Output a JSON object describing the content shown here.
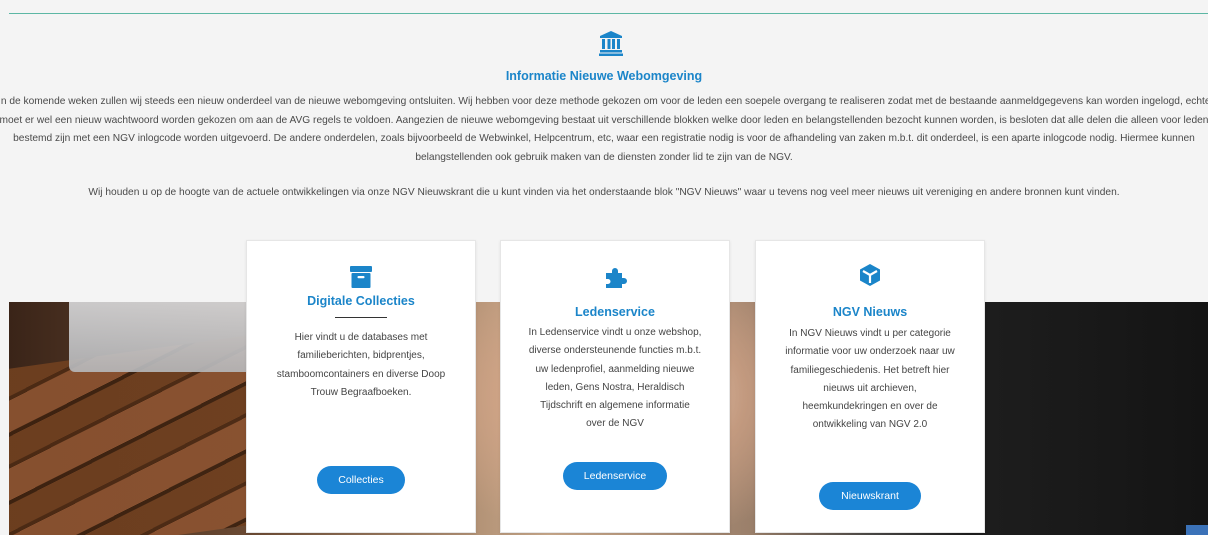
{
  "info": {
    "title": "Informatie Nieuwe Webomgeving",
    "paragraph_lines": [
      "In de komende weken zullen wij steeds een nieuw onderdeel van de nieuwe webomgeving ontsluiten. Wij hebben voor deze methode gekozen om voor de leden een soepele overgang te realiseren zodat met de bestaande aanmeldgegevens kan worden ingelogd, echter",
      "moet er wel een nieuw wachtwoord worden gekozen om aan de AVG regels te voldoen. Aangezien de nieuwe webomgeving bestaat uit verschillende blokken welke door leden en belangstellenden bezocht kunnen worden, is besloten dat alle delen die alleen voor leden",
      "bestemd zijn met een NGV inlogcode worden uitgevoerd. De andere onderdelen, zoals bijvoorbeeld de Webwinkel, Helpcentrum, etc, waar een registratie nodig is voor de afhandeling van zaken m.b.t. dit onderdeel, is een aparte inlogcode nodig. Hiermee kunnen",
      "belangstellenden ook gebruik maken van de diensten zonder lid te zijn van de NGV."
    ],
    "paragraph2": "Wij houden u op de hoogte van de actuele ontwikkelingen via onze NGV Nieuwskrant die u kunt vinden via het onderstaande blok \"NGV Nieuws\" waar u tevens nog veel meer nieuws uit vereniging en andere bronnen kunt vinden."
  },
  "cards": [
    {
      "icon": "archive-box-icon",
      "title": "Digitale Collecties",
      "body_lines": [
        "Hier vindt u de databases met",
        "familieberichten, bidprentjes,",
        "stamboomcontainers en diverse Doop",
        "Trouw Begraafboeken."
      ],
      "button": "Collecties"
    },
    {
      "icon": "puzzle-piece-icon",
      "title": "Ledenservice",
      "body_lines": [
        "In Ledenservice vindt u onze webshop,",
        "diverse ondersteunende functies m.b.t.",
        "uw ledenprofiel, aanmelding nieuwe",
        "leden, Gens Nostra, Heraldisch",
        "Tijdschrift en algemene informatie",
        "over de NGV"
      ],
      "button": "Ledenservice"
    },
    {
      "icon": "cube-icon",
      "title": "NGV Nieuws",
      "body_lines": [
        "In NGV Nieuws vindt u per categorie",
        "informatie voor uw onderzoek naar uw",
        "familiegeschiedenis. Het betreft hier",
        "nieuws uit archieven,",
        "heemkundekringen en over de",
        "ontwikkeling van NGV 2.0"
      ],
      "button": "Nieuwskrant"
    }
  ],
  "colors": {
    "accent": "#1b85c9",
    "button": "#1b85d6",
    "divider": "#5cb7a4"
  }
}
